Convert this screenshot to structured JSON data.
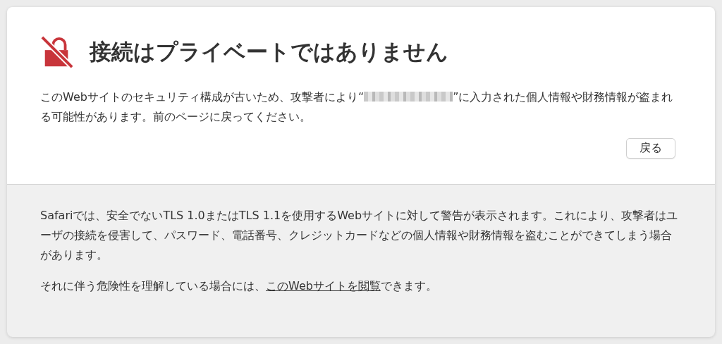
{
  "warning": {
    "title": "接続はプライベートではありません",
    "message": {
      "before": "このWebサイトのセキュリティ構成が古いため、攻撃者により“",
      "redacted": true,
      "after": "”に入力された個人情報や財務情報が盗まれる可能性があります。前のページに戻ってください。"
    },
    "back_button": "戻る"
  },
  "details": {
    "explanation": "Safariでは、安全でないTLS 1.0またはTLS 1.1を使用するWebサイトに対して警告が表示されます。これにより、攻撃者はユーザの接続を侵害して、パスワード、電話番号、クレジットカードなどの個人情報や財務情報を盗むことができてしまう場合があります。",
    "proceed": {
      "before": "それに伴う危険性を理解している場合には、",
      "link": "このWebサイトを閲覧",
      "after": "できます。"
    }
  }
}
